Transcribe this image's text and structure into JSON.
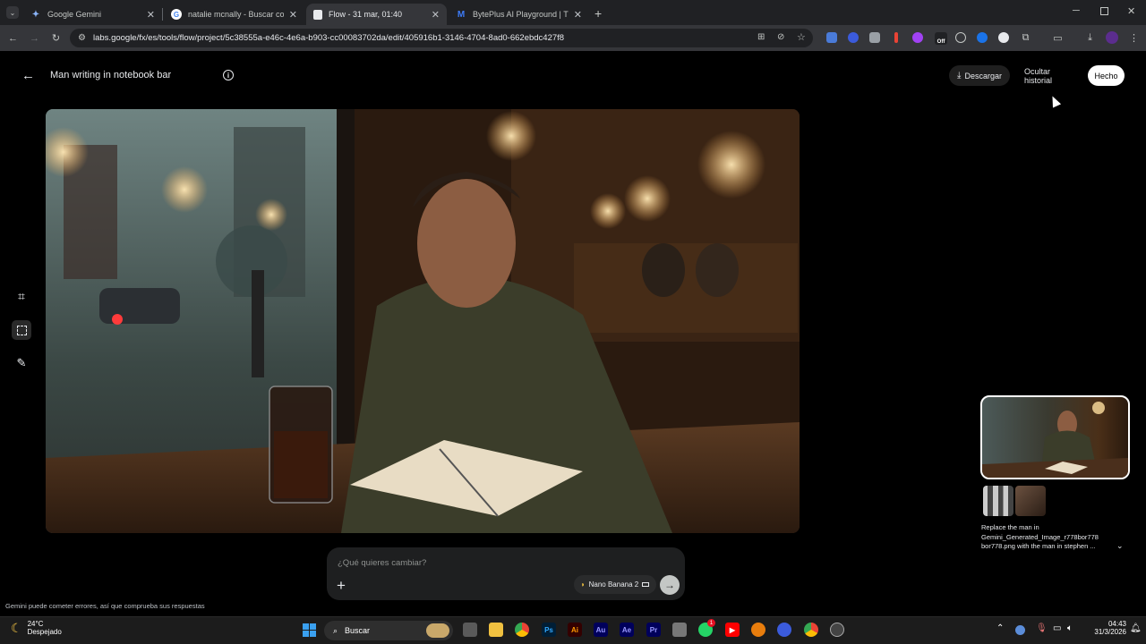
{
  "browser": {
    "tabs": [
      {
        "title": "Google Gemini",
        "active": false
      },
      {
        "title": "natalie mcnally - Buscar con Google",
        "active": false
      },
      {
        "title": "Flow - 31 mar, 01:40",
        "active": true
      },
      {
        "title": "BytePlus AI Playground | Try Ad",
        "active": false
      }
    ],
    "url": "labs.google/fx/es/tools/flow/project/5c38555a-e46c-4e6a-b903-cc00083702da/edit/405916b1-3146-4704-8ad0-662ebdc427f8",
    "ext_badge": "Off"
  },
  "app": {
    "title": "Man writing in notebook bar",
    "download_label": "Descargar",
    "hide_history_label": "Ocultar historial",
    "done_label": "Hecho",
    "prompt_placeholder": "¿Qué quieres cambiar?",
    "model_label": "Nano Banana 2",
    "disclaimer": "Gemini puede cometer errores, así que comprueba sus respuestas",
    "history_caption": "Replace the man in Gemini_Generated_Image_r778bor778 bor778.png with the man in stephen ..."
  },
  "taskbar": {
    "weather_temp": "24°C",
    "weather_desc": "Despejado",
    "search_label": "Buscar",
    "time": "04:43",
    "date": "31/3/2026",
    "badge_count": "1"
  }
}
